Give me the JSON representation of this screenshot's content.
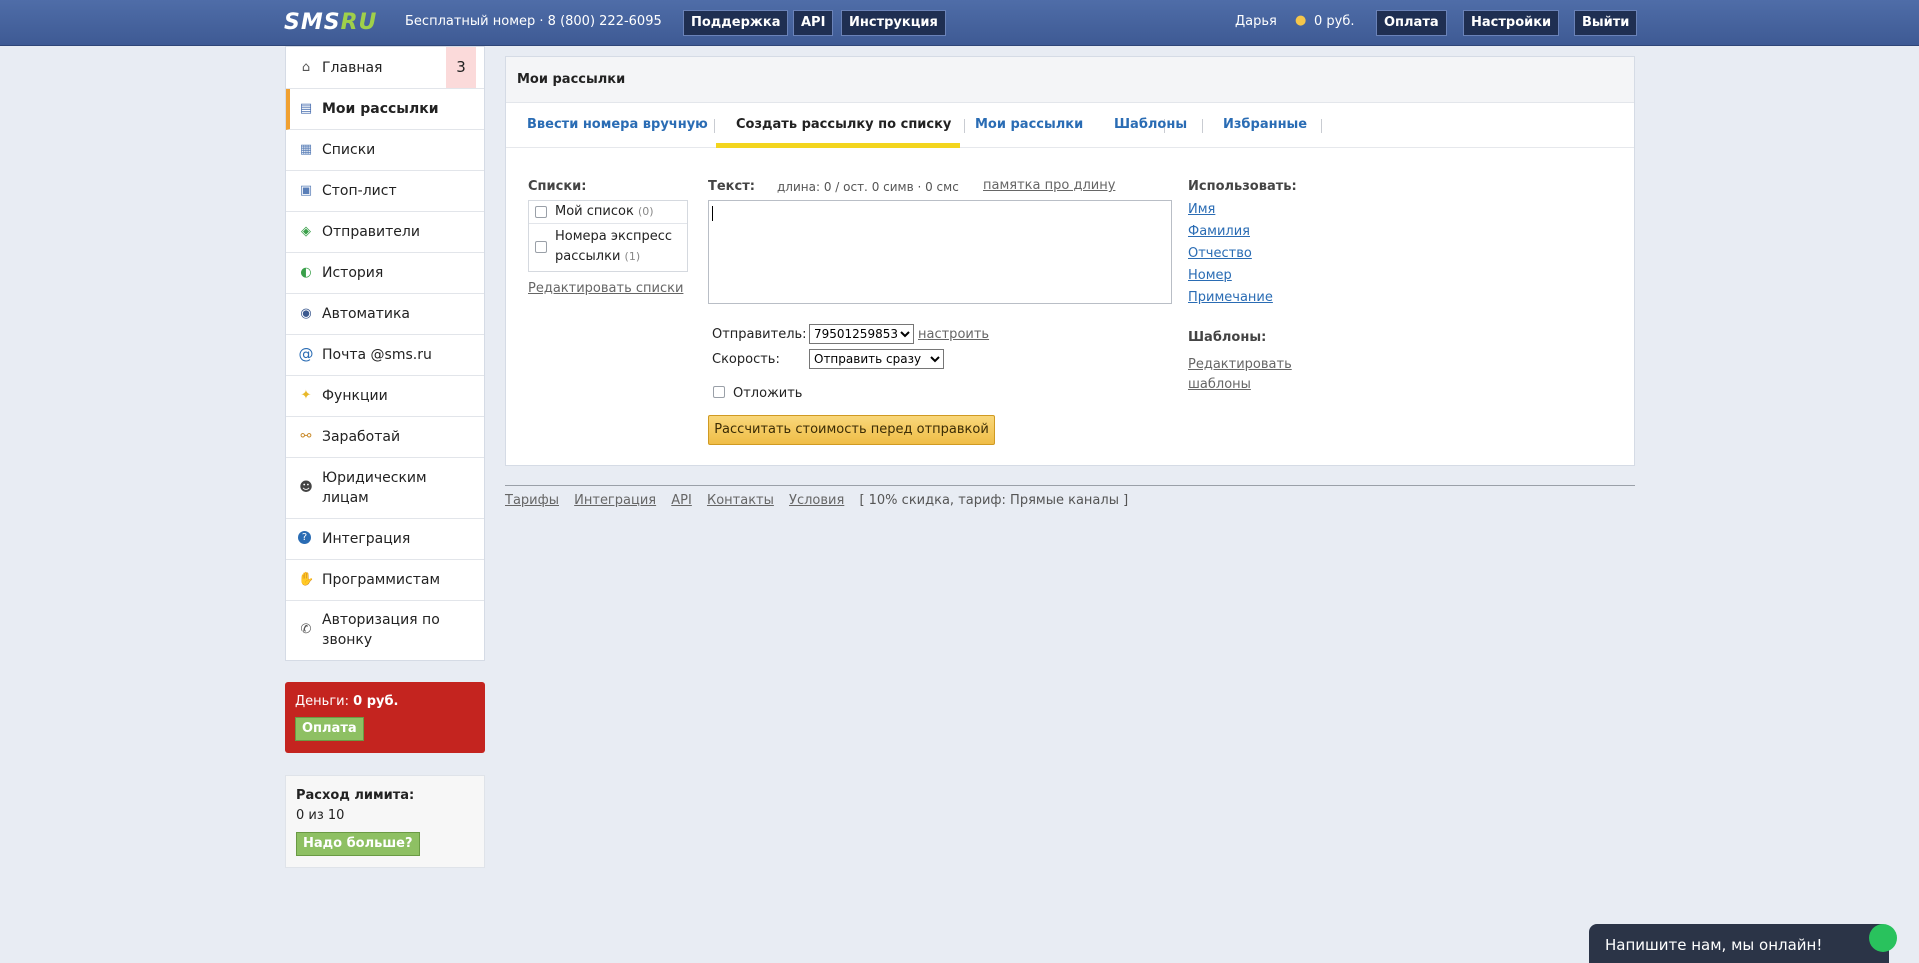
{
  "topbar": {
    "logo_main": "SMS",
    "logo_accent": "RU",
    "phone": "Бесплатный номер · 8 (800) 222-6095",
    "buttons": {
      "support": "Поддержка",
      "api": "API",
      "manual": "Инструкция",
      "pay": "Оплата",
      "settings": "Настройки",
      "logout": "Выйти"
    },
    "user": "Дарья",
    "coins_icon": "coins-icon",
    "balance": "0 руб."
  },
  "sidebar": {
    "items": [
      {
        "label": "Главная",
        "icon": "home-icon",
        "glyph": "⌂",
        "badge": "3"
      },
      {
        "label": "Мои рассылки",
        "icon": "mailings-icon",
        "glyph": "▤"
      },
      {
        "label": "Списки",
        "icon": "lists-icon",
        "glyph": "▦"
      },
      {
        "label": "Стоп-лист",
        "icon": "stoplist-icon",
        "glyph": "▣"
      },
      {
        "label": "Отправители",
        "icon": "tag-icon",
        "glyph": "◈"
      },
      {
        "label": "История",
        "icon": "history-icon",
        "glyph": "◐"
      },
      {
        "label": "Автоматика",
        "icon": "robot-icon",
        "glyph": "◉"
      },
      {
        "label": "Почта @sms.ru",
        "icon": "at-icon",
        "glyph": "@"
      },
      {
        "label": "Функции",
        "icon": "bulb-icon",
        "glyph": "✦"
      },
      {
        "label": "Заработай",
        "icon": "handshake-icon",
        "glyph": "⚯"
      },
      {
        "label": "Юридическим лицам",
        "icon": "person-icon",
        "glyph": "☻"
      },
      {
        "label": "Интеграция",
        "icon": "help-icon",
        "glyph": "?"
      },
      {
        "label": "Программистам",
        "icon": "hand-icon",
        "glyph": "✋"
      },
      {
        "label": "Авторизация по звонку",
        "icon": "phone-icon",
        "glyph": "✆"
      }
    ]
  },
  "money": {
    "label": "Деньги:",
    "value": "0 руб.",
    "button": "Оплата"
  },
  "limit": {
    "title": "Расход лимита:",
    "value": "0 из 10",
    "button": "Надо больше?"
  },
  "panel": {
    "title": "Мои рассылки",
    "tabs": [
      "Ввести номера вручную",
      "Создать рассылку по списку",
      "Мои рассылки",
      "Шаблоны",
      "Избранные"
    ],
    "lists_label": "Списки:",
    "lists": [
      {
        "name": "Мой список",
        "count": "(0)"
      },
      {
        "name_line1": "Номера экспресс",
        "name_line2": "рассылки",
        "count": "(1)"
      }
    ],
    "edit_lists": "Редактировать списки",
    "text_label": "Текст:",
    "text_meta": "длина: 0 / ост. 0 симв · 0 смс",
    "length_note": "памятка про длину",
    "sender_label": "Отправитель:",
    "sender_value": "79501259853",
    "configure": "настроить",
    "speed_label": "Скорость:",
    "speed_value": "Отправить сразу",
    "postpone": "Отложить",
    "calc_button": "Рассчитать стоимость перед отправкой",
    "use_label": "Использовать:",
    "use_links": [
      "Имя",
      "Фамилия",
      "Отчество",
      "Номер",
      "Примечание"
    ],
    "templates_label": "Шаблоны:",
    "edit_templates_1": "Редактировать",
    "edit_templates_2": "шаблоны"
  },
  "footer": {
    "links": [
      "Тарифы",
      "Интеграция",
      "API",
      "Контакты",
      "Условия"
    ],
    "note": "[ 10% скидка, тариф: Прямые каналы ]"
  },
  "chat": {
    "text": "Напишите нам, мы онлайн!"
  }
}
